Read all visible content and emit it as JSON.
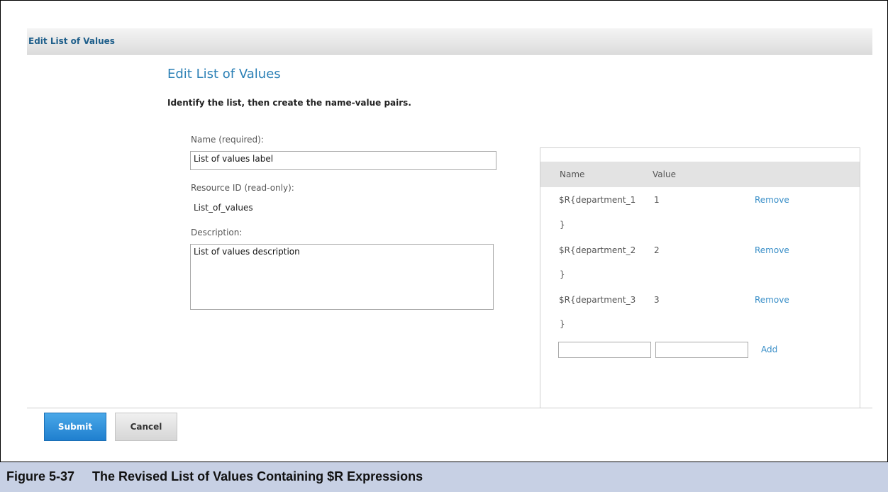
{
  "panel": {
    "header_title": "Edit List of Values"
  },
  "page": {
    "title": "Edit List of Values",
    "instructions": "Identify the list, then create the name-value pairs."
  },
  "form": {
    "name_label": "Name (required):",
    "name_value": "List of values label",
    "resource_id_label": "Resource ID (read-only):",
    "resource_id_value": "List_of_values",
    "description_label": "Description:",
    "description_value": "List of values description"
  },
  "lov_table": {
    "columns": [
      "Name",
      "Value"
    ],
    "rows": [
      {
        "name_line1": "$R{department_1",
        "name_line2": "}",
        "value": "1",
        "action": "Remove"
      },
      {
        "name_line1": "$R{department_2",
        "name_line2": "}",
        "value": "2",
        "action": "Remove"
      },
      {
        "name_line1": "$R{department_3",
        "name_line2": "}",
        "value": "3",
        "action": "Remove"
      }
    ],
    "add_label": "Add"
  },
  "buttons": {
    "submit": "Submit",
    "cancel": "Cancel"
  },
  "caption": {
    "text": "Figure 5-37     The Revised List of Values Containing $R Expressions"
  },
  "colors": {
    "accent": "#2a7fb5",
    "submit_bg": "#2a8ad6",
    "caption_bg": "#c7d0e4",
    "link": "#3a8fc8"
  }
}
